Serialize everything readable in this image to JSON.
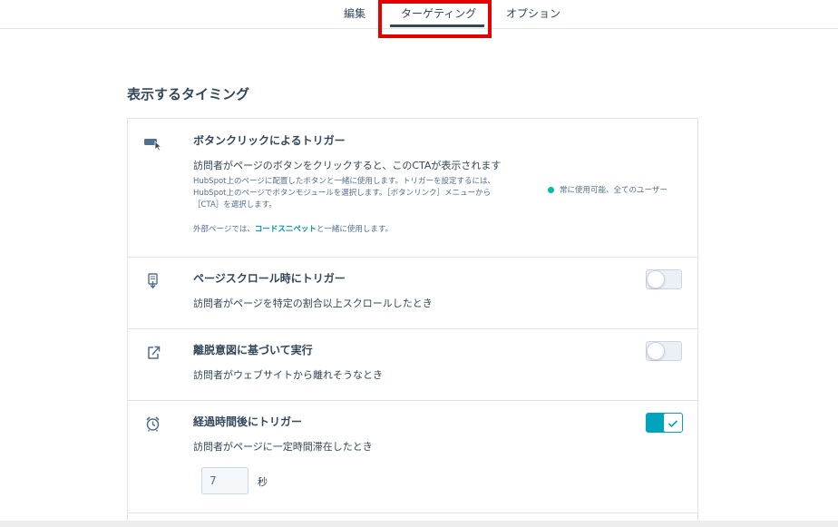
{
  "tabs": {
    "edit": "編集",
    "targeting": "ターゲティング",
    "options": "オプション"
  },
  "section_title": "表示するタイミング",
  "cards": {
    "button_click": {
      "title": "ボタンクリックによるトリガー",
      "description": "訪問者がページのボタンをクリックすると、このCTAが表示されます",
      "help_line1": "HubSpot上のページに配置したボタンと一緒に使用します。トリガーを設定するには、",
      "help_line2": "HubSpot上のページでボタンモジュールを選択します。［ボタンリンク］メニューから",
      "help_line3": "［CTA］を選択します。",
      "external_prefix": "外部ページでは、",
      "external_link": "コードスニペット",
      "external_suffix": "と一緒に使用します。",
      "status": "常に使用可能、全てのユーザー"
    },
    "page_scroll": {
      "title": "ページスクロール時にトリガー",
      "description": "訪問者がページを特定の割合以上スクロールしたとき",
      "enabled": false
    },
    "exit_intent": {
      "title": "離脱意図に基づいて実行",
      "description": "訪問者がウェブサイトから離れそうなとき",
      "enabled": false
    },
    "time_elapsed": {
      "title": "経過時間後にトリガー",
      "description": "訪問者がページに一定時間滞在したとき",
      "enabled": true,
      "seconds_value": "7",
      "seconds_unit": "秒"
    }
  },
  "colors": {
    "accent": "#00a4bd",
    "status_dot": "#00bda5",
    "link": "#0091ae",
    "highlight": "#e60000"
  }
}
